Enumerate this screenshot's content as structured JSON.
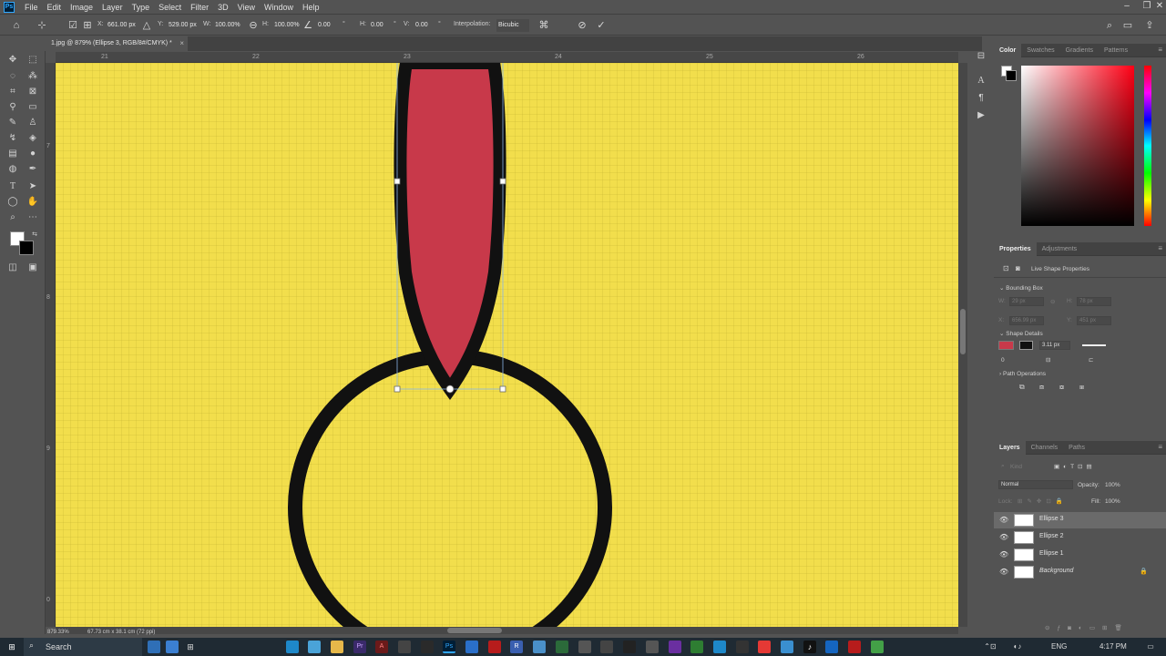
{
  "app": {
    "logo": "Ps"
  },
  "menu": [
    "File",
    "Edit",
    "Image",
    "Layer",
    "Type",
    "Select",
    "Filter",
    "3D",
    "View",
    "Window",
    "Help"
  ],
  "window_controls": [
    "–",
    "❐",
    "✕"
  ],
  "options": {
    "x_label": "X:",
    "x_value": "661.00 px",
    "y_label": "Y:",
    "y_value": "529.00 px",
    "w_label": "W:",
    "w_value": "100.00%",
    "h_label": "H:",
    "h_value": "100.00%",
    "angle_value": "0.00",
    "hskew_label": "H:",
    "hskew_value": "0.00",
    "vskew_label": "V:",
    "vskew_value": "0.00",
    "interp_label": "Interpolation:",
    "interp_value": "Bicubic"
  },
  "document": {
    "tab_title": "1.jpg @ 879% (Ellipse 3, RGB/8#/CMYK) *",
    "close": "×"
  },
  "rulers": {
    "h_labels": [
      "21",
      "22",
      "23",
      "24",
      "25",
      "26"
    ],
    "v_labels": [
      "7",
      "8",
      "9",
      "0"
    ]
  },
  "status": {
    "zoom": "879.33%",
    "doc_size": "67.73 cm x 38.1 cm (72 ppi)"
  },
  "colors": {
    "canvas_yellow": "#f2de4c",
    "ellipse_fill": "#c8394a",
    "stroke": "#111111",
    "accent": "#31a8ff"
  },
  "panels": {
    "color": {
      "tabs": [
        "Color",
        "Swatches",
        "Gradients",
        "Patterns"
      ]
    },
    "properties": {
      "tabs": [
        "Properties",
        "Adjustments"
      ],
      "title": "Live Shape Properties",
      "bounding_box": "Bounding Box",
      "w_label": "W:",
      "w_value": "29 px",
      "h_label": "H:",
      "h_value": "78 px",
      "x_label": "X:",
      "x_value": "656.99 px",
      "y_label": "Y:",
      "y_value": "451 px",
      "shape_details": "Shape Details",
      "stroke_width": "3.11 px",
      "corner_value": "0",
      "path_operations": "Path Operations"
    },
    "layers": {
      "tabs": [
        "Layers",
        "Channels",
        "Paths"
      ],
      "kind_placeholder": "Kind",
      "blend_mode": "Normal",
      "opacity_label": "Opacity:",
      "opacity_value": "100%",
      "lock_label": "Lock:",
      "fill_label": "Fill:",
      "fill_value": "100%",
      "items": [
        {
          "name": "Ellipse 3",
          "selected": true
        },
        {
          "name": "Ellipse 2",
          "selected": false
        },
        {
          "name": "Ellipse 1",
          "selected": false
        },
        {
          "name": "Background",
          "selected": false
        }
      ]
    }
  },
  "taskbar": {
    "search_placeholder": "Search",
    "lang": "ENG",
    "time": "4:17 PM"
  }
}
